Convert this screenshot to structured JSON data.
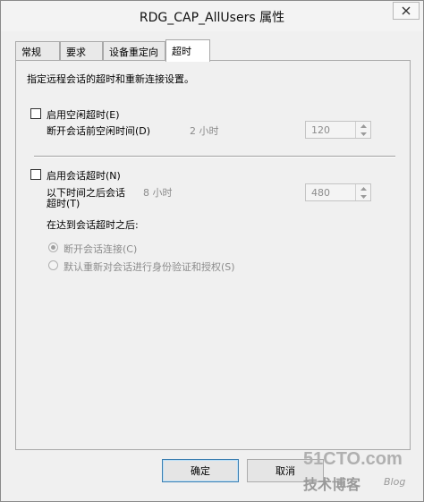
{
  "window": {
    "title": "RDG_CAP_AllUsers 属性"
  },
  "tabs": [
    {
      "label": "常规"
    },
    {
      "label": "要求"
    },
    {
      "label": "设备重定向"
    },
    {
      "label": "超时"
    }
  ],
  "panel": {
    "description": "指定远程会话的超时和重新连接设置。",
    "idle_timeout": {
      "checkbox_label": "启用空闲超时(E)",
      "checked": false,
      "field_label": "断开会话前空闲时间(D)",
      "hint": "2 小时",
      "value": "120"
    },
    "session_timeout": {
      "checkbox_label": "启用会话超时(N)",
      "checked": false,
      "field_label_line1": "以下时间之后会话",
      "field_label_line2": "超时(T)",
      "hint": "8 小时",
      "value": "480",
      "after_label": "在达到会话超时之后:",
      "options": [
        {
          "label": "断开会话连接(C)",
          "selected": true
        },
        {
          "label": "默认重新对会话进行身份验证和授权(S)",
          "selected": false
        }
      ]
    }
  },
  "buttons": {
    "ok": "确定",
    "cancel": "取消"
  },
  "watermark": {
    "site": "51CTO.com",
    "line2": "技术博客",
    "blog": "Blog"
  }
}
